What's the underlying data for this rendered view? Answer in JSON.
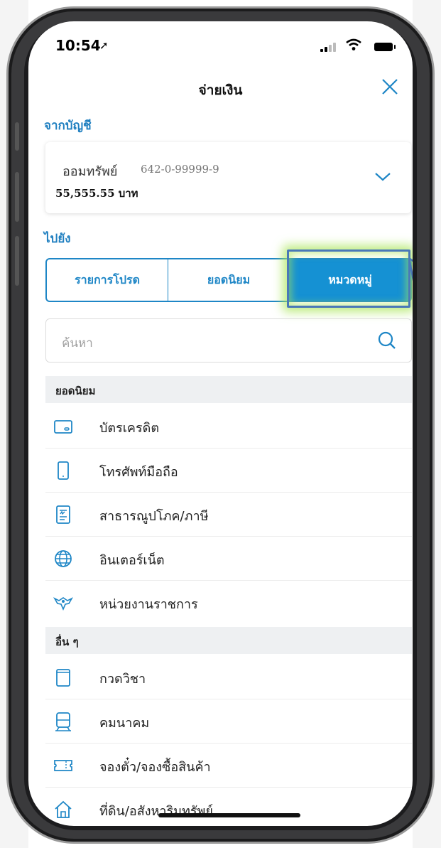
{
  "status_bar": {
    "time": "10:54"
  },
  "header": {
    "title": "จ่ายเงิน"
  },
  "from_section": {
    "label": "จากบัญชี",
    "account_name": "ออมทรัพย์",
    "account_number": "642-0-99999-9",
    "balance": "55,555.55 บาท"
  },
  "to_section": {
    "label": "ไปยัง",
    "tabs": [
      {
        "label": "รายการโปรด",
        "active": false
      },
      {
        "label": "ยอดนิยม",
        "active": false
      },
      {
        "label": "หมวดหมู่",
        "active": true
      }
    ]
  },
  "search": {
    "placeholder": "ค้นหา"
  },
  "groups": [
    {
      "title": "ยอดนิยม",
      "items": [
        {
          "label": "บัตรเครดิต",
          "icon": "credit-card-icon"
        },
        {
          "label": "โทรศัพท์มือถือ",
          "icon": "mobile-phone-icon"
        },
        {
          "label": "สาธารณูปโภค/ภาษี",
          "icon": "utility-bill-icon"
        },
        {
          "label": "อินเตอร์เน็ต",
          "icon": "globe-icon"
        },
        {
          "label": "หน่วยงานราชการ",
          "icon": "government-emblem-icon"
        }
      ]
    },
    {
      "title": "อื่น ๆ",
      "items": [
        {
          "label": "กวดวิชา",
          "icon": "book-icon"
        },
        {
          "label": "คมนาคม",
          "icon": "train-icon"
        },
        {
          "label": "จองตั๋ว/จองซื้อสินค้า",
          "icon": "ticket-icon"
        },
        {
          "label": "ที่ดิน/อสังหาริมทรัพย์",
          "icon": "house-icon"
        }
      ]
    }
  ],
  "colors": {
    "accent": "#1e86c6",
    "active_tab": "#1591d3",
    "highlight_glow": "#aae65a",
    "highlight_border": "#4a78b8"
  }
}
